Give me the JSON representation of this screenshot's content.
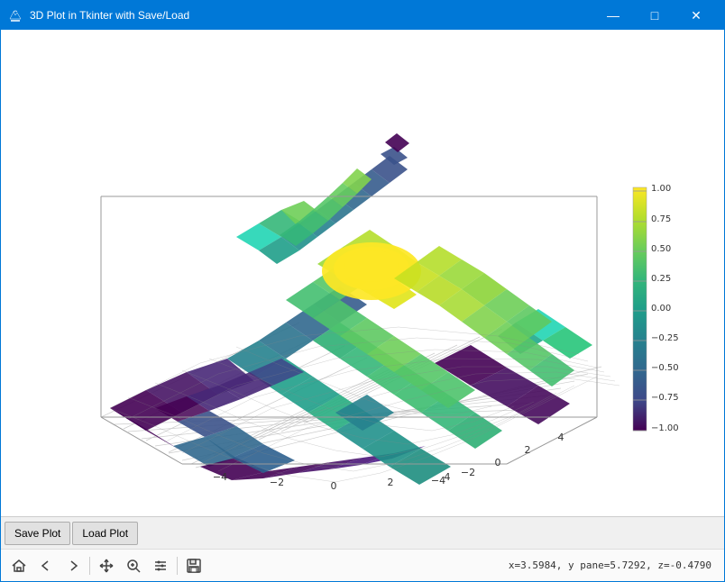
{
  "window": {
    "title": "3D Plot in Tkinter with Save/Load",
    "icon": "🖊"
  },
  "titlebar": {
    "minimize": "—",
    "maximize": "□",
    "close": "✕"
  },
  "buttons": {
    "save_plot": "Save Plot",
    "load_plot": "Load Plot"
  },
  "toolbar": {
    "status": "x=3.5984, y pane=5.7292, z=-0.4790"
  },
  "plot": {
    "colorbar": {
      "values": [
        "1.00",
        "0.75",
        "0.50",
        "0.25",
        "0.00",
        "−0.25",
        "−0.50",
        "−0.75",
        "−1.00"
      ]
    },
    "x_axis_labels": [
      "−4",
      "−2",
      "0",
      "2",
      "4"
    ],
    "y_axis_labels": [
      "4",
      "2",
      "0",
      "−2",
      "−4"
    ]
  },
  "icons": {
    "home": "⌂",
    "back": "←",
    "forward": "→",
    "move": "✥",
    "zoom": "🔍",
    "settings": "⚙",
    "save": "💾",
    "app": "✒"
  }
}
